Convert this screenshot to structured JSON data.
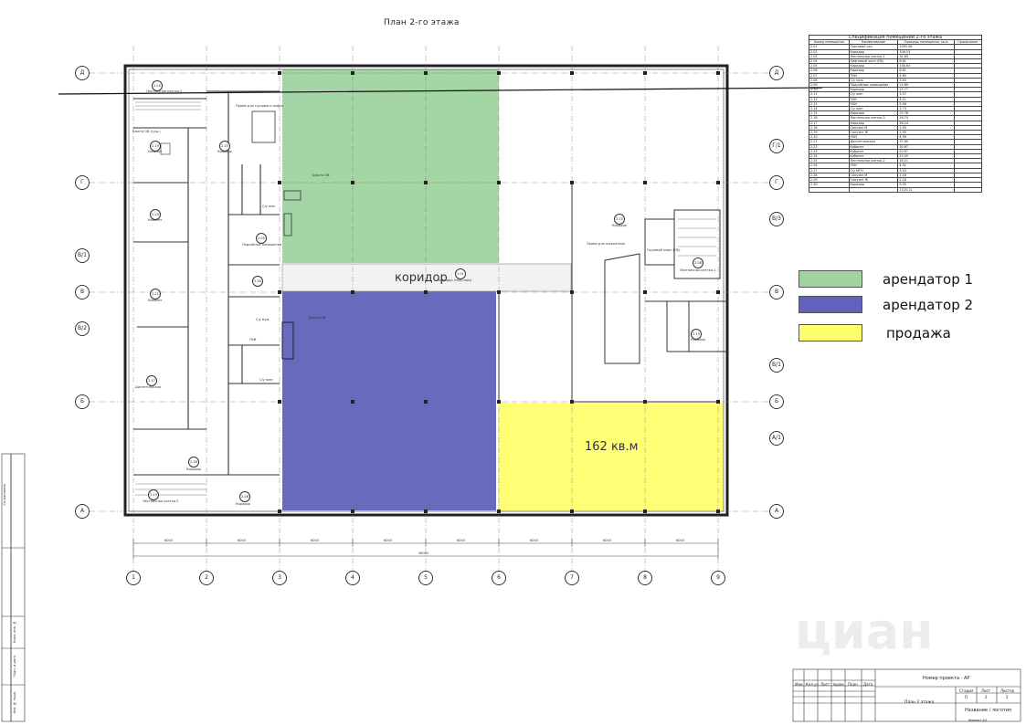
{
  "sheet_title": "План 2-го этажа",
  "legend": [
    {
      "label": "арендатор 1",
      "color": "#9fd3a0"
    },
    {
      "label": "арендатор 2",
      "color": "#5f63bb"
    },
    {
      "label": "продажа",
      "color": "#ffff6e"
    }
  ],
  "zones": {
    "corridor_label": "коридор",
    "sale_area_label": "162 кв.м",
    "colors": {
      "tenant1": "#9fd3a0",
      "tenant2": "#5f63bb",
      "sale": "#ffff6e"
    }
  },
  "axes": {
    "columns": [
      "1",
      "2",
      "3",
      "4",
      "5",
      "6",
      "7",
      "8",
      "9"
    ],
    "rows_left": [
      "Д",
      "Г",
      "В/1",
      "В",
      "В/2",
      "Б",
      "А"
    ],
    "rows_right": [
      "Д",
      "Г/1",
      "Г",
      "В/3",
      "В",
      "В/1",
      "Б",
      "А/1",
      "А"
    ]
  },
  "dimensions": {
    "segments": [
      "6000",
      "6000",
      "6000",
      "6000",
      "6000",
      "6000",
      "6000",
      "6000"
    ],
    "total": "48000"
  },
  "rooms": [
    {
      "num": "2.01",
      "name": "Торговый зал"
    },
    {
      "num": "2.15",
      "name": "Коридор"
    },
    {
      "num": "2.16",
      "name": "Коридор"
    },
    {
      "num": "2.19",
      "name": "Кабинет"
    },
    {
      "num": "2.20",
      "name": "Кабинет"
    },
    {
      "num": "2.21",
      "name": "Кабинет"
    },
    {
      "num": "2.17",
      "name": "Диспетчерская"
    },
    {
      "num": "2.18",
      "name": "Коридор"
    },
    {
      "num": "2.05",
      "name": "Подсобные помещения"
    },
    {
      "num": "2.25",
      "name": "Лестничная клетка-2"
    },
    {
      "num": "2.10",
      "name": "Коридор"
    },
    {
      "num": "2.08",
      "name": "Лестничная клетка-1"
    },
    {
      "num": "2.23",
      "name": "Лестничная клетка-3"
    }
  ],
  "room_labels": {
    "stair2": "Лестничная клетка-2",
    "shaft_exist": "Шахта ОВ (сущ.)",
    "cabinet": "Кабинет",
    "corridor": "Коридор",
    "freight": "Проем для грузового лифта",
    "aux": "Подсобные помещения",
    "shaft": "Шахта ОВ",
    "wc": "С/у муж",
    "wc_f": "С/у жен",
    "pui": "ПУИ",
    "dispatch": "Диспетчерская",
    "stair3": "Лестничная клетка-3",
    "stair1": "Лестничная клетка-1",
    "escalator": "Проем для эскалатора",
    "freight_lift": "Грузовой лифт (ПБ)",
    "corr_mid": "коридор (техн.пом)",
    "right_corr": "Коридор"
  },
  "spec_table": {
    "title": "Спецификация помещений 2-го этажа",
    "headers": [
      "Номер помещения",
      "Наименование",
      "Площадь помещения, кв.м",
      "Примечание"
    ],
    "rows": [
      [
        "2.01",
        "Торговый зал",
        "1095.56"
      ],
      [
        "2.02",
        "Коридор",
        "106.53"
      ],
      [
        "2.03",
        "Лестничная клетка-1",
        "34.60"
      ],
      [
        "2.04",
        "Лифтовый холл (ПБ)",
        "6.61"
      ],
      [
        "2.05",
        "Коридор",
        "158.63"
      ],
      [
        "2.06",
        "Коридор",
        "6.81"
      ],
      [
        "2.07",
        "ПУИ",
        "5.65"
      ],
      [
        "2.08",
        "С/у муж",
        "3.63"
      ],
      [
        "2.09",
        "Подсобные помещения",
        "15.69"
      ],
      [
        "2.10",
        "Коридор",
        "15.77"
      ],
      [
        "2.11",
        "С/у жен",
        "3.57"
      ],
      [
        "2.12",
        "ПУИ",
        "4.21"
      ],
      [
        "2.13",
        "ПУИ",
        "5.46"
      ],
      [
        "2.14",
        "С/у жен",
        "3.73"
      ],
      [
        "2.15",
        "Коридор",
        "19.78"
      ],
      [
        "2.16",
        "Лестничная клетка-3",
        "16.74"
      ],
      [
        "2.17",
        "Коридор",
        "56.24"
      ],
      [
        "2.18",
        "Санузел М",
        "1.95"
      ],
      [
        "2.19",
        "Санузел Ж",
        "1.95"
      ],
      [
        "2.20",
        "ПУИ",
        "4.99"
      ],
      [
        "2.21",
        "Диспетчерская",
        "37.80"
      ],
      [
        "2.22",
        "Кабинет",
        "30.67"
      ],
      [
        "2.23",
        "Кабинет",
        "20.97"
      ],
      [
        "2.24",
        "Кабинет",
        "25.55"
      ],
      [
        "2.25",
        "Лестничная клетка-2",
        "16.21"
      ],
      [
        "2.26",
        "ПУИ",
        "4.41"
      ],
      [
        "2.27",
        "С/у МГН",
        "3.43"
      ],
      [
        "2.28",
        "Санузел М",
        "2.16"
      ],
      [
        "2.29",
        "Санузел Ж",
        "2.16"
      ],
      [
        "2.30",
        "Коридор",
        "5.05"
      ],
      [
        "",
        "",
        "1720.11"
      ]
    ]
  },
  "title_block": {
    "project": "Номер проекта - АР",
    "sheet_name": "План 2 этажа",
    "stage_h": "Стадия",
    "sheet_h": "Лист",
    "sheets_h": "Листов",
    "stage": "П",
    "sheet": "2",
    "sheets": "2",
    "company": "Название / логотип",
    "format": "Формат А3",
    "cols": [
      "Изм.",
      "Кол.уч.",
      "Лист",
      "№док.",
      "Подп.",
      "Дата"
    ]
  },
  "side_stamps": [
    "Согласовано",
    "Взам. инв. №",
    "Подп. и дата",
    "Инв. № подл."
  ],
  "watermark": "циан"
}
